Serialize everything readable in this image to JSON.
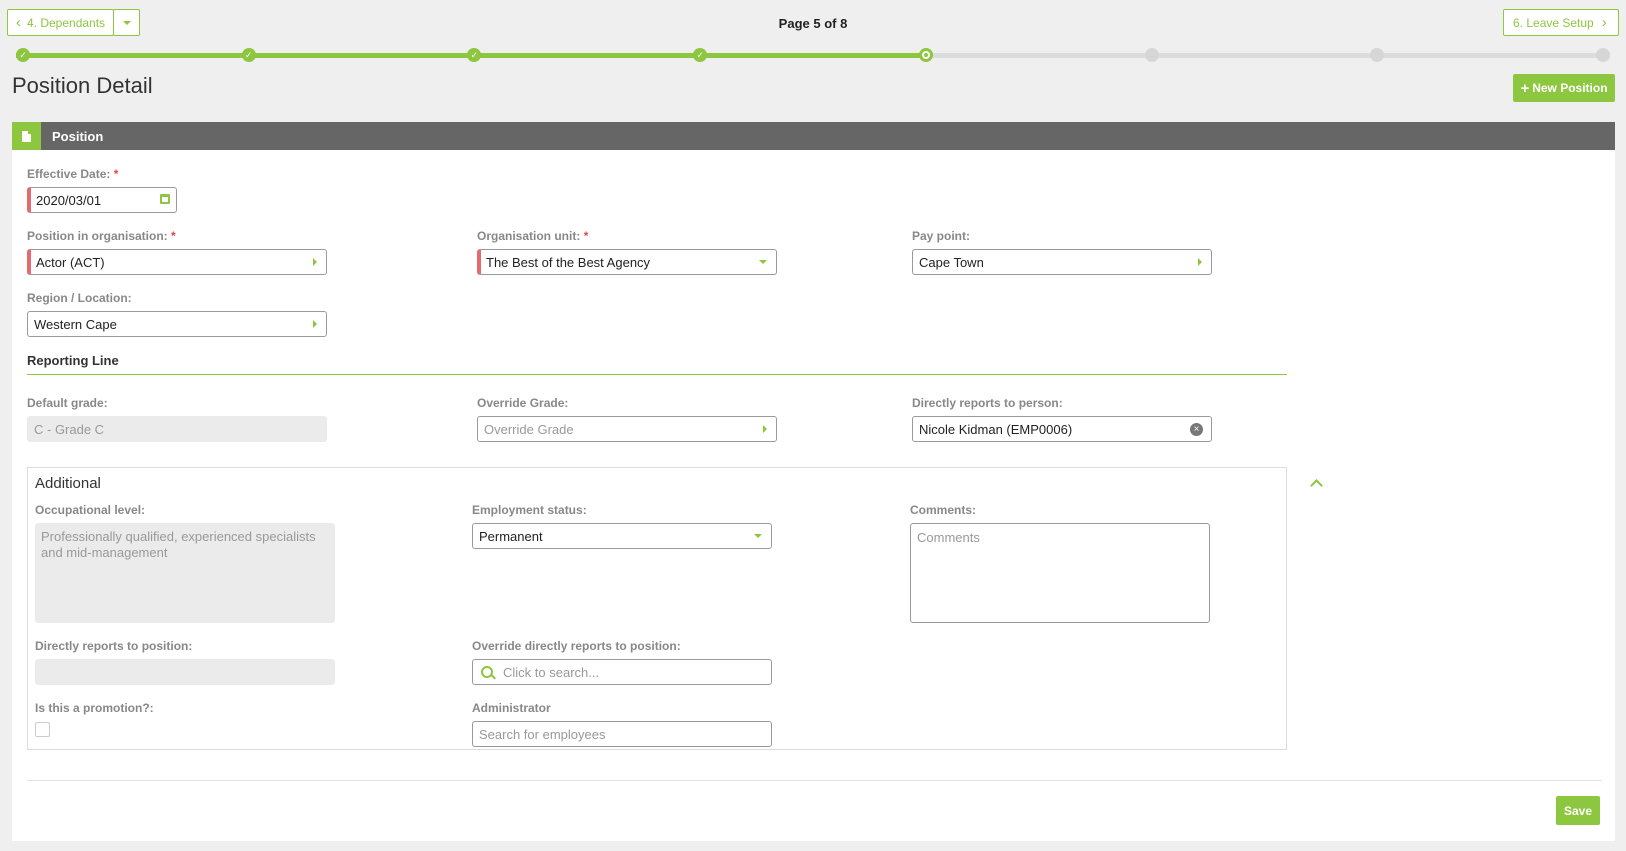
{
  "nav": {
    "prev_label": "4. Dependants",
    "next_label": "6. Leave Setup",
    "page_indicator": "Page 5 of 8",
    "total_steps": 8,
    "current_step": 5
  },
  "page": {
    "title": "Position Detail",
    "new_position_label": "New Position"
  },
  "panel": {
    "title": "Position"
  },
  "form": {
    "effective_date": {
      "label": "Effective Date:",
      "required_mark": "*",
      "value": "2020/03/01"
    },
    "position_in_org": {
      "label": "Position in organisation:",
      "required_mark": "*",
      "value": "Actor (ACT)"
    },
    "org_unit": {
      "label": "Organisation unit:",
      "required_mark": "*",
      "value": "The Best of the Best Agency"
    },
    "pay_point": {
      "label": "Pay point:",
      "value": "Cape Town"
    },
    "region": {
      "label": "Region / Location:",
      "value": "Western Cape"
    }
  },
  "reporting": {
    "title": "Reporting Line",
    "default_grade": {
      "label": "Default grade:",
      "value": "C - Grade C"
    },
    "override_grade": {
      "label": "Override Grade:",
      "placeholder": "Override Grade"
    },
    "reports_to_person": {
      "label": "Directly reports to person:",
      "value": "Nicole Kidman (EMP0006)"
    }
  },
  "additional": {
    "title": "Additional",
    "occupational_level": {
      "label": "Occupational level:",
      "value": "Professionally qualified, experienced specialists and mid-management"
    },
    "employment_status": {
      "label": "Employment status:",
      "value": "Permanent"
    },
    "comments": {
      "label": "Comments:",
      "placeholder": "Comments"
    },
    "reports_to_position": {
      "label": "Directly reports to position:",
      "value": ""
    },
    "override_reports_to_position": {
      "label": "Override directly reports to position:",
      "placeholder": "Click to search..."
    },
    "promotion": {
      "label": "Is this a promotion?:",
      "checked": false
    },
    "administrator": {
      "label": "Administrator",
      "placeholder": "Search for employees"
    }
  },
  "footer": {
    "save_label": "Save"
  },
  "colors": {
    "accent": "#8dc63f",
    "required": "#e46a6e",
    "header_bar": "#666666"
  }
}
